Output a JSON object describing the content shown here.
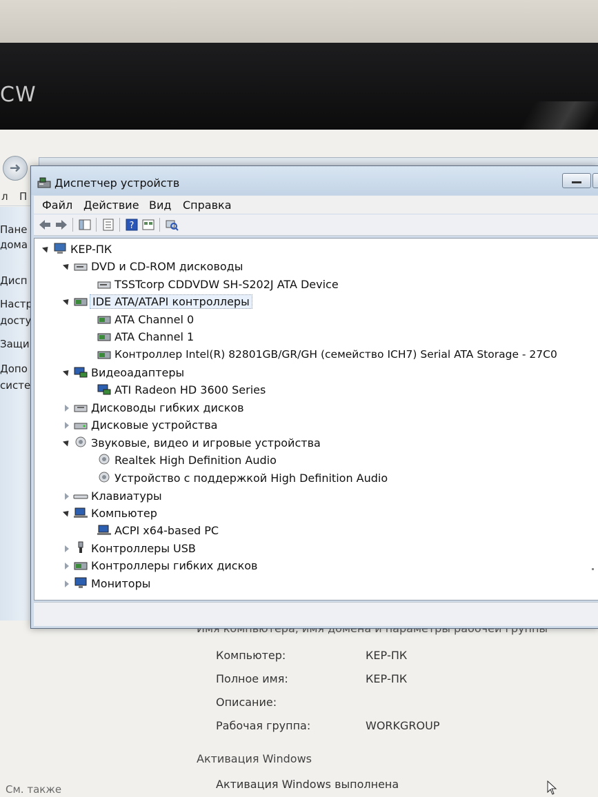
{
  "monitor": {
    "brand_fragment": "CW"
  },
  "background_window": {
    "menu_fragments": [
      "л",
      "П"
    ],
    "sidebar_fragments": [
      "Пане",
      "дома",
      "Дисп",
      "Настр",
      "досту",
      "Защи",
      "Допо",
      "систе"
    ],
    "section_header": "Имя компьютера, имя домена и параметры рабочей группы",
    "fields": [
      {
        "label": "Компьютер:",
        "value": "КЕР-ПК"
      },
      {
        "label": "Полное имя:",
        "value": "КЕР-ПК"
      },
      {
        "label": "Описание:",
        "value": ""
      },
      {
        "label": "Рабочая группа:",
        "value": "WORKGROUP"
      }
    ],
    "activation_header": "Активация Windows",
    "activation_status": "Активация Windows выполнена",
    "see_also": "См. также"
  },
  "device_manager": {
    "title": "Диспетчер устройств",
    "menu": [
      "Файл",
      "Действие",
      "Вид",
      "Справка"
    ],
    "toolbar_icons": [
      "back-arrow-icon",
      "forward-arrow-icon",
      "console-tree-icon",
      "properties-icon",
      "help-icon",
      "view-icon",
      "scan-hardware-icon"
    ],
    "tree": {
      "root": "КЕР-ПК",
      "categories": [
        {
          "name": "DVD и CD-ROM дисководы",
          "expanded": true,
          "icon": "dvd-drive-icon",
          "children": [
            "TSSTcorp CDDVDW SH-S202J ATA Device"
          ]
        },
        {
          "name": "IDE ATA/ATAPI контроллеры",
          "expanded": true,
          "selected": true,
          "icon": "ide-controller-icon",
          "children": [
            "ATA Channel 0",
            "ATA Channel 1",
            "Контроллер Intel(R) 82801GB/GR/GH (семейство ICH7) Serial ATA Storage - 27C0"
          ]
        },
        {
          "name": "Видеоадаптеры",
          "expanded": true,
          "icon": "display-adapter-icon",
          "children": [
            "ATI Radeon HD 3600 Series"
          ]
        },
        {
          "name": "Дисководы гибких дисков",
          "expanded": false,
          "icon": "floppy-drive-icon",
          "children": []
        },
        {
          "name": "Дисковые устройства",
          "expanded": false,
          "icon": "disk-drive-icon",
          "children": []
        },
        {
          "name": "Звуковые, видео и игровые устройства",
          "expanded": true,
          "icon": "sound-device-icon",
          "children": [
            "Realtek High Definition Audio",
            "Устройство с поддержкой High Definition Audio"
          ]
        },
        {
          "name": "Клавиатуры",
          "expanded": false,
          "icon": "keyboard-icon",
          "children": []
        },
        {
          "name": "Компьютер",
          "expanded": true,
          "icon": "computer-icon",
          "children": [
            "ACPI x64-based PC"
          ]
        },
        {
          "name": "Контроллеры USB",
          "expanded": false,
          "icon": "usb-controller-icon",
          "children": []
        },
        {
          "name": "Контроллеры гибких дисков",
          "expanded": false,
          "icon": "floppy-controller-icon",
          "children": []
        },
        {
          "name": "Мониторы",
          "expanded": false,
          "icon": "monitor-icon",
          "children": []
        }
      ]
    }
  },
  "colors": {
    "selection_border": "#7aa7d6",
    "title_bar": "#c3d4e6"
  }
}
